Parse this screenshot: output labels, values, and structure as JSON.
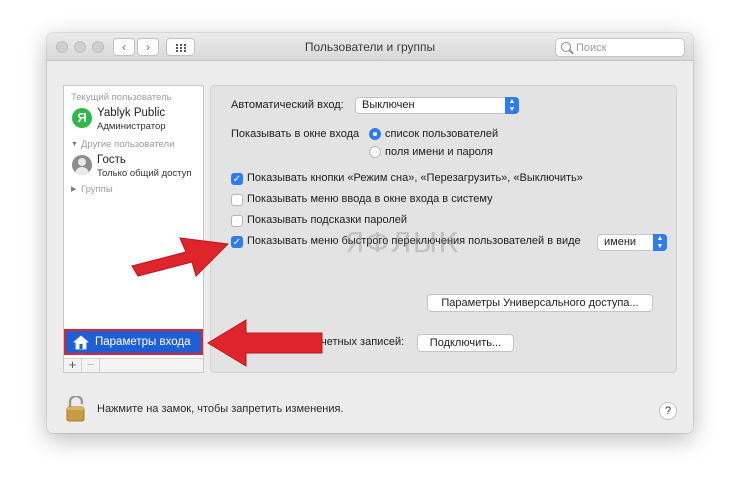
{
  "window": {
    "title": "Пользователи и группы",
    "search_placeholder": "Поиск"
  },
  "sidebar": {
    "current_user_header": "Текущий пользователь",
    "current_user": {
      "name": "Yablyk Public",
      "role": "Администратор",
      "avatar_letter": "Я"
    },
    "other_users_header": "Другие пользователи",
    "guest": {
      "name": "Гость",
      "role": "Только общий доступ"
    },
    "groups_label": "Группы",
    "login_options_label": "Параметры входа",
    "add_label": "+",
    "remove_label": "−"
  },
  "panel": {
    "auto_login_label": "Автоматический вход:",
    "auto_login_value": "Выключен",
    "show_in_login_window_label": "Показывать в окне входа",
    "radio_user_list": "список пользователей",
    "radio_name_password": "поля имени и пароля",
    "check_sleep_restart": "Показывать кнопки «Режим сна», «Перезагрузить», «Выключить»",
    "check_input_menu": "Показывать меню ввода в окне входа в систему",
    "check_password_hints": "Показывать подсказки паролей",
    "check_fast_switch": "Показывать меню быстрого переключения пользователей в виде",
    "fast_switch_value": "имени",
    "accessibility_button": "Параметры Универсального доступа...",
    "network_accounts_label": "четных записей:",
    "connect_button": "Подключить..."
  },
  "footer": {
    "lock_text": "Нажмите на замок, чтобы запретить изменения.",
    "help_label": "?"
  },
  "watermark": "ЯФЛЫК",
  "colors": {
    "accent": "#2f7bf0",
    "selection": "#1f5fd6",
    "annotation_red": "#e0242b",
    "avatar_green": "#2fb84a"
  }
}
